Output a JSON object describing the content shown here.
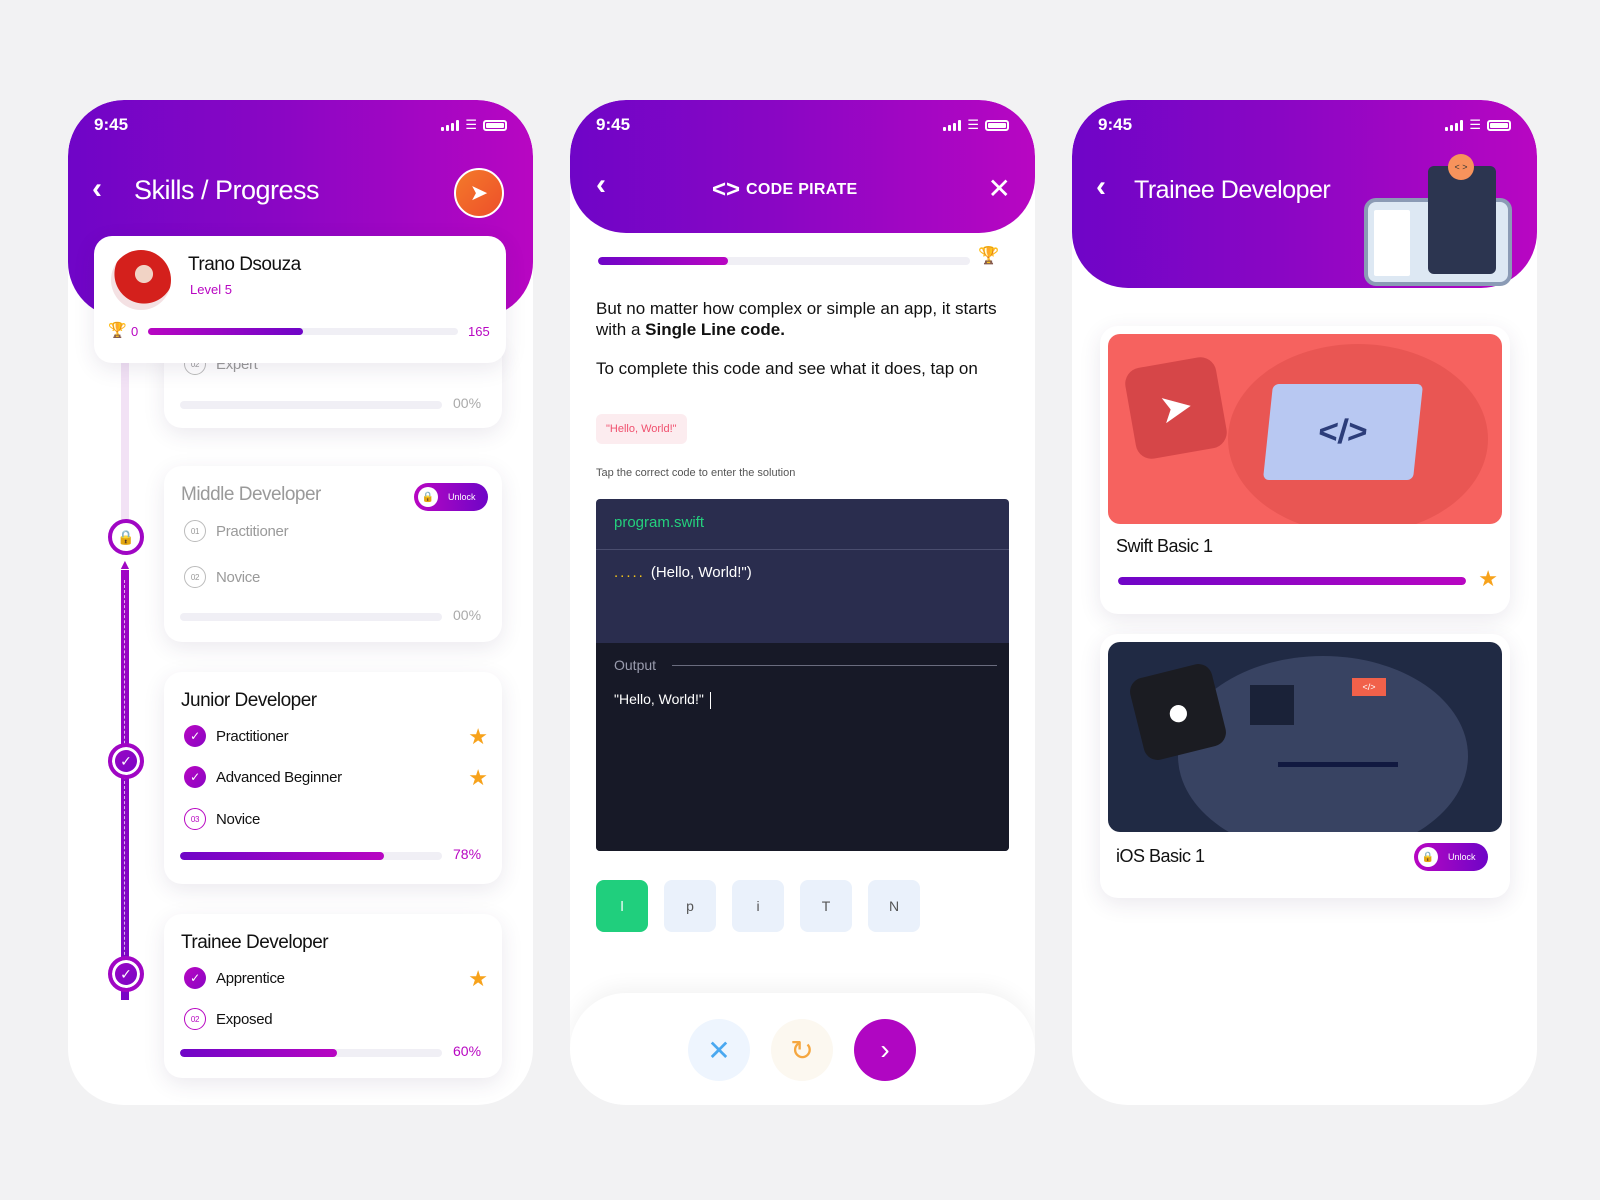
{
  "status_time": "9:45",
  "screen1": {
    "title": "Skills / Progress",
    "profile": {
      "name": "Trano Dsouza",
      "level": "Level 5",
      "xp_min": "0",
      "xp_max": "165",
      "xp_progress": 0.5
    },
    "levels": [
      {
        "title": "Expert (partial)",
        "steps": [
          {
            "num": "02",
            "label": "Expert",
            "state": "locked"
          }
        ],
        "percent_label": "00%",
        "progress": 0
      },
      {
        "title": "Middle Developer",
        "unlock_label": "Unlock",
        "steps": [
          {
            "num": "01",
            "label": "Practitioner",
            "state": "locked"
          },
          {
            "num": "02",
            "label": "Novice",
            "state": "locked"
          }
        ],
        "percent_label": "00%",
        "progress": 0
      },
      {
        "title": "Junior Developer",
        "steps": [
          {
            "num": "01",
            "label": "Practitioner",
            "state": "done",
            "star": true
          },
          {
            "num": "02",
            "label": "Advanced Beginner",
            "state": "done",
            "star": true
          },
          {
            "num": "03",
            "label": "Novice",
            "state": "current"
          }
        ],
        "percent_label": "78%",
        "progress": 0.78
      },
      {
        "title": "Trainee Developer",
        "steps": [
          {
            "num": "01",
            "label": "Apprentice",
            "state": "done",
            "star": true
          },
          {
            "num": "02",
            "label": "Exposed",
            "state": "current"
          }
        ],
        "percent_label": "60%",
        "progress": 0.6
      }
    ]
  },
  "screen2": {
    "brand": "CODE PIRATE",
    "lesson_progress": 0.35,
    "paragraph1_a": "But no matter how complex or simple an app, it starts with a ",
    "paragraph1_b": "Single Line code.",
    "paragraph2": "To complete this code and see what it does, tap on",
    "hint_chip": "\"Hello, World!\"",
    "instruction": "Tap the correct code to enter the solution",
    "editor": {
      "filename": "program.swift",
      "blank": ".....",
      "code": "(Hello, World!\")",
      "output_label": "Output",
      "output": "\"Hello, World!\""
    },
    "chips": [
      "l",
      "p",
      "i",
      "T",
      "N"
    ],
    "selected_chip": 0
  },
  "screen3": {
    "title": "Trainee Developer",
    "courses": [
      {
        "title": "Swift Basic 1",
        "progress": 1.0,
        "star": true
      },
      {
        "title": "iOS Basic 1",
        "unlock_label": "Unlock"
      }
    ]
  }
}
